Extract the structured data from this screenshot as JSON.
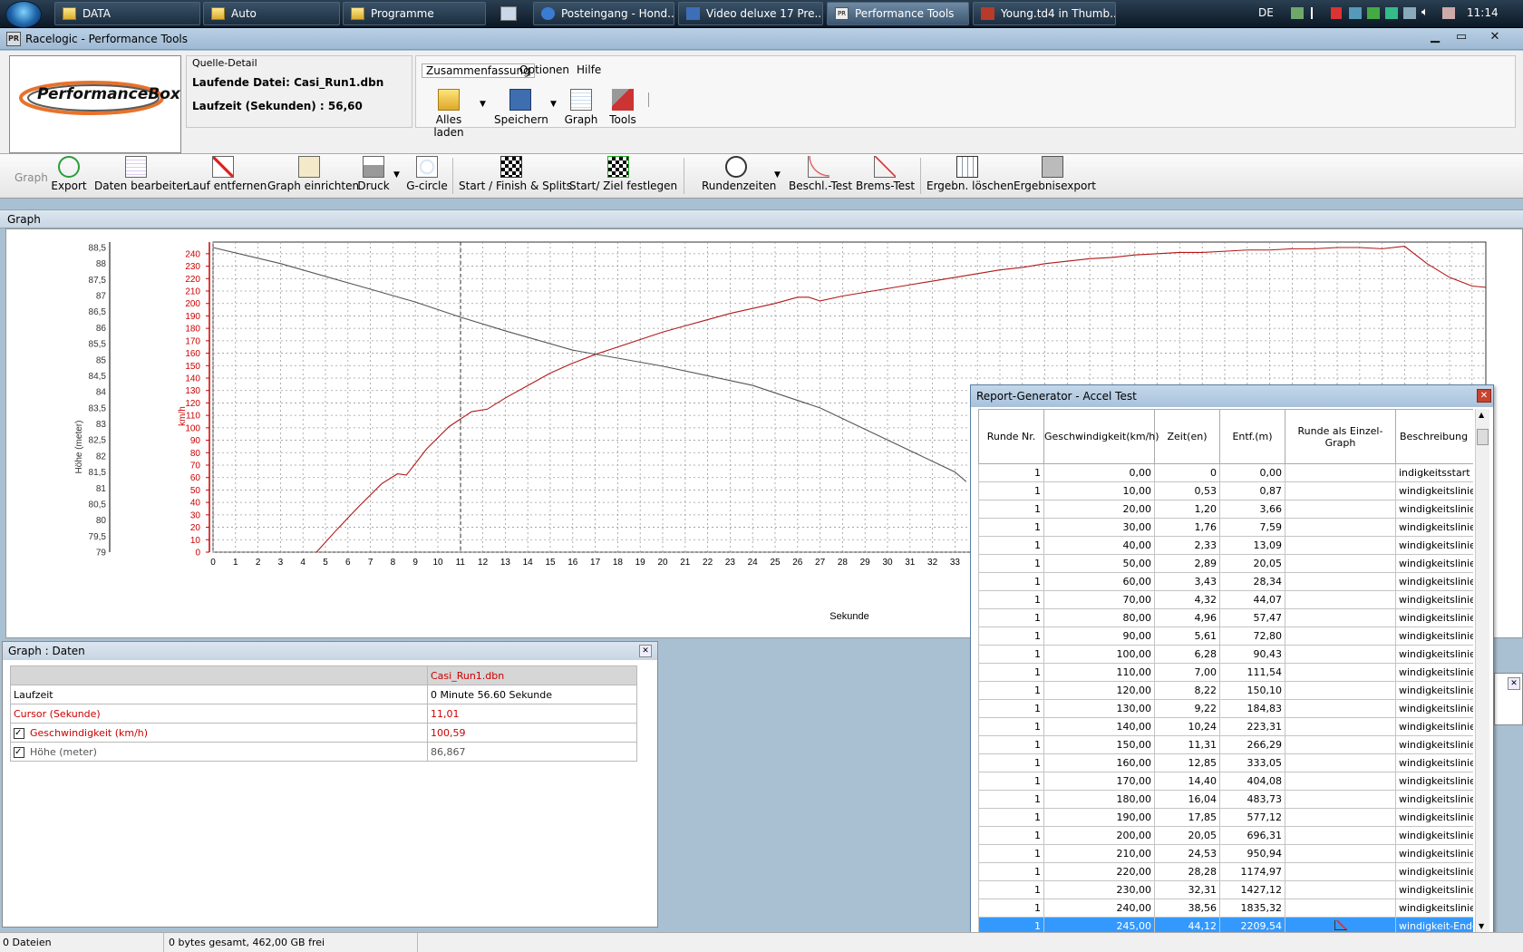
{
  "taskbar": {
    "buttons": [
      "DATA",
      "Auto",
      "Programme",
      "Posteingang - Hond...",
      "Video deluxe 17 Pre...",
      "Performance Tools",
      "Young.td4 in Thumb..."
    ],
    "tray_lang": "DE",
    "clock": "11:14"
  },
  "window": {
    "title": "Racelogic - Performance Tools",
    "logo_text": "PerformanceBox"
  },
  "quelle": {
    "legend": "Quelle-Detail",
    "file_line": "Laufende Datei: Casi_Run1.dbn",
    "time_line": "Laufzeit (Sekunden) : 56,60"
  },
  "ribbon": {
    "menus": [
      "Zusammenfassung",
      "Optionen",
      "Hilfe"
    ],
    "buttons": [
      "Alles laden",
      "Speichern",
      "Graph",
      "Tools"
    ]
  },
  "toolbar": {
    "graph_label": "Graph",
    "buttons": [
      "Export",
      "Daten bearbeiten",
      "Lauf entfernen",
      "Graph einrichten",
      "Druck",
      "G-circle",
      "Start / Finish & Splits",
      "Start/ Ziel festlegen",
      "Rundenzeiten",
      "Beschl.-Test",
      "Brems-Test",
      "Ergebn. löschen",
      "Ergebnisexport"
    ]
  },
  "graph": {
    "header": "Graph"
  },
  "chart_data": {
    "type": "line",
    "xlabel": "Sekunde",
    "ylabel_left": "Höhe (meter)",
    "ylabel_right": "km/h",
    "xlim": [
      0,
      56.6
    ],
    "x_ticks_visible": [
      0,
      1,
      2,
      3,
      4,
      5,
      6,
      7,
      8,
      9,
      10,
      11,
      12,
      13,
      14,
      15,
      16,
      17,
      18,
      19,
      20,
      21,
      22,
      23,
      24,
      25,
      26,
      27,
      28,
      29,
      30,
      31,
      32,
      33
    ],
    "y_left_ticks": [
      "88,5",
      "88",
      "87,5",
      "87",
      "86,5",
      "86",
      "85,5",
      "85",
      "84,5",
      "84",
      "83,5",
      "83",
      "82,5",
      "82",
      "81,5",
      "81",
      "80,5",
      "80",
      "79,5",
      "79"
    ],
    "y_left_range": [
      79,
      88.5
    ],
    "y_speed_ticks": [
      240,
      230,
      220,
      210,
      200,
      190,
      180,
      170,
      160,
      150,
      140,
      130,
      120,
      110,
      100,
      90,
      80,
      70,
      60,
      50,
      40,
      30,
      20,
      10,
      0
    ],
    "y_speed_range": [
      0,
      245
    ],
    "cursor_x": 11.01,
    "series": [
      {
        "name": "Geschwindigkeit (km/h)",
        "color": "#b01818",
        "x": [
          4.6,
          5.5,
          6.5,
          7.5,
          8.2,
          8.6,
          9.5,
          10.5,
          11.5,
          12.2,
          13,
          14,
          15,
          16,
          17,
          18,
          19,
          20,
          21,
          22,
          23,
          24,
          25,
          26,
          26.5,
          27,
          28,
          29,
          30,
          31,
          32,
          33,
          34,
          35,
          36,
          37,
          38,
          39,
          40,
          41,
          42,
          43,
          44,
          45,
          46,
          47,
          48,
          49,
          50,
          51,
          52,
          53,
          54,
          55,
          56,
          56.6
        ],
        "y": [
          0,
          18,
          37,
          55,
          63,
          62,
          83,
          101,
          113,
          115,
          124,
          134,
          144,
          152,
          159,
          165,
          171,
          177,
          182,
          187,
          192,
          196,
          200,
          205,
          205,
          202,
          206,
          209,
          212,
          215,
          218,
          221,
          224,
          227,
          229,
          232,
          234,
          236,
          237,
          239,
          240,
          241,
          241,
          242,
          243,
          243,
          244,
          244,
          245,
          245,
          244,
          246,
          232,
          221,
          214,
          213
        ]
      },
      {
        "name": "Höhe (meter)",
        "color": "#555555",
        "x": [
          0,
          3,
          6,
          9,
          11,
          13,
          16,
          20,
          24,
          27,
          30,
          33,
          33.5
        ],
        "y": [
          88.5,
          88.0,
          87.4,
          86.8,
          86.33,
          85.9,
          85.3,
          84.8,
          84.2,
          83.5,
          82.5,
          81.5,
          81.2
        ]
      }
    ]
  },
  "data_panel": {
    "title": "Graph : Daten",
    "file_header": "Casi_Run1.dbn",
    "rows": [
      {
        "label": "Laufzeit",
        "value": "0 Minute 56.60 Sekunde"
      },
      {
        "label": "Cursor (Sekunde)",
        "value": "11,01"
      },
      {
        "label": "Geschwindigkeit (km/h)",
        "value": "100,59"
      },
      {
        "label": "Höhe (meter)",
        "value": "86,867"
      }
    ]
  },
  "report": {
    "title": "Report-Generator - Accel Test",
    "columns": [
      "Runde Nr.",
      "Geschwindigkeit(km/h)",
      "Zeit(en)",
      "Entf.(m)",
      "Runde als Einzel-Graph",
      "Beschreibung"
    ],
    "rows": [
      [
        "1",
        "0,00",
        "0",
        "0,00",
        "indigkeitsstart"
      ],
      [
        "1",
        "10,00",
        "0,53",
        "0,87",
        "windigkeitslinie"
      ],
      [
        "1",
        "20,00",
        "1,20",
        "3,66",
        "windigkeitslinie"
      ],
      [
        "1",
        "30,00",
        "1,76",
        "7,59",
        "windigkeitslinie"
      ],
      [
        "1",
        "40,00",
        "2,33",
        "13,09",
        "windigkeitslinie"
      ],
      [
        "1",
        "50,00",
        "2,89",
        "20,05",
        "windigkeitslinie"
      ],
      [
        "1",
        "60,00",
        "3,43",
        "28,34",
        "windigkeitslinie"
      ],
      [
        "1",
        "70,00",
        "4,32",
        "44,07",
        "windigkeitslinie"
      ],
      [
        "1",
        "80,00",
        "4,96",
        "57,47",
        "windigkeitslinie"
      ],
      [
        "1",
        "90,00",
        "5,61",
        "72,80",
        "windigkeitslinie"
      ],
      [
        "1",
        "100,00",
        "6,28",
        "90,43",
        "windigkeitslinie"
      ],
      [
        "1",
        "110,00",
        "7,00",
        "111,54",
        "windigkeitslinie"
      ],
      [
        "1",
        "120,00",
        "8,22",
        "150,10",
        "windigkeitslinie"
      ],
      [
        "1",
        "130,00",
        "9,22",
        "184,83",
        "windigkeitslinie"
      ],
      [
        "1",
        "140,00",
        "10,24",
        "223,31",
        "windigkeitslinie"
      ],
      [
        "1",
        "150,00",
        "11,31",
        "266,29",
        "windigkeitslinie"
      ],
      [
        "1",
        "160,00",
        "12,85",
        "333,05",
        "windigkeitslinie"
      ],
      [
        "1",
        "170,00",
        "14,40",
        "404,08",
        "windigkeitslinie"
      ],
      [
        "1",
        "180,00",
        "16,04",
        "483,73",
        "windigkeitslinie"
      ],
      [
        "1",
        "190,00",
        "17,85",
        "577,12",
        "windigkeitslinie"
      ],
      [
        "1",
        "200,00",
        "20,05",
        "696,31",
        "windigkeitslinie"
      ],
      [
        "1",
        "210,00",
        "24,53",
        "950,94",
        "windigkeitslinie"
      ],
      [
        "1",
        "220,00",
        "28,28",
        "1174,97",
        "windigkeitslinie"
      ],
      [
        "1",
        "230,00",
        "32,31",
        "1427,12",
        "windigkeitslinie"
      ],
      [
        "1",
        "240,00",
        "38,56",
        "1835,32",
        "windigkeitslinie"
      ],
      [
        "1",
        "245,00",
        "44,12",
        "2209,54",
        "windigkeit-Ende"
      ]
    ]
  },
  "status": {
    "left": "0 Dateien",
    "middle": "0 bytes gesamt, 462,00 GB frei"
  }
}
